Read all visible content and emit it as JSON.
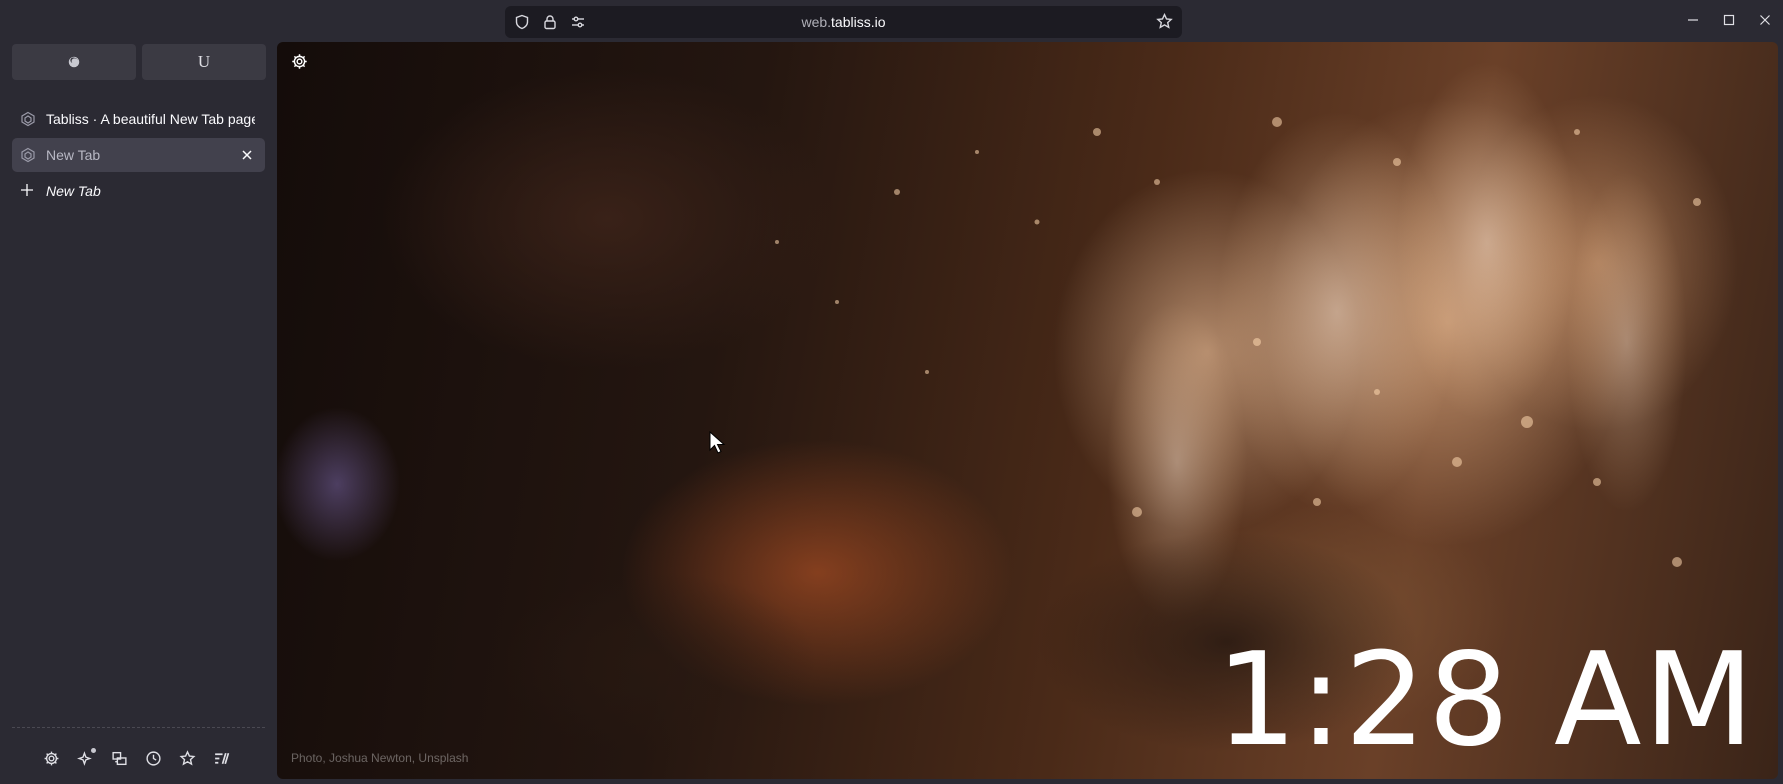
{
  "browser": {
    "url_prefix": "web.",
    "url_domain": "tabliss.io",
    "pinned_tabs": [
      {
        "label": "",
        "icon": "firefox-icon"
      },
      {
        "label": "U"
      }
    ],
    "tabs": [
      {
        "title": "Tabliss · A beautiful New Tab page f",
        "active": false,
        "icon": "tabliss-icon"
      },
      {
        "title": "New Tab",
        "active": true,
        "icon": "tabliss-icon"
      }
    ],
    "new_tab_label": "New Tab",
    "tool_icons": [
      "settings-icon",
      "sparkle-icon",
      "sidebar-icon",
      "history-icon",
      "bookmark-star-icon",
      "zen-icon"
    ]
  },
  "page": {
    "clock": "1:28 AM",
    "credit": "Photo, Joshua Newton, Unsplash"
  },
  "colors": {
    "chrome_bg": "#2b2a33",
    "urlbar_bg": "#1c1b22",
    "active_tab_bg": "#42414d",
    "text": "#fbfbfe"
  }
}
